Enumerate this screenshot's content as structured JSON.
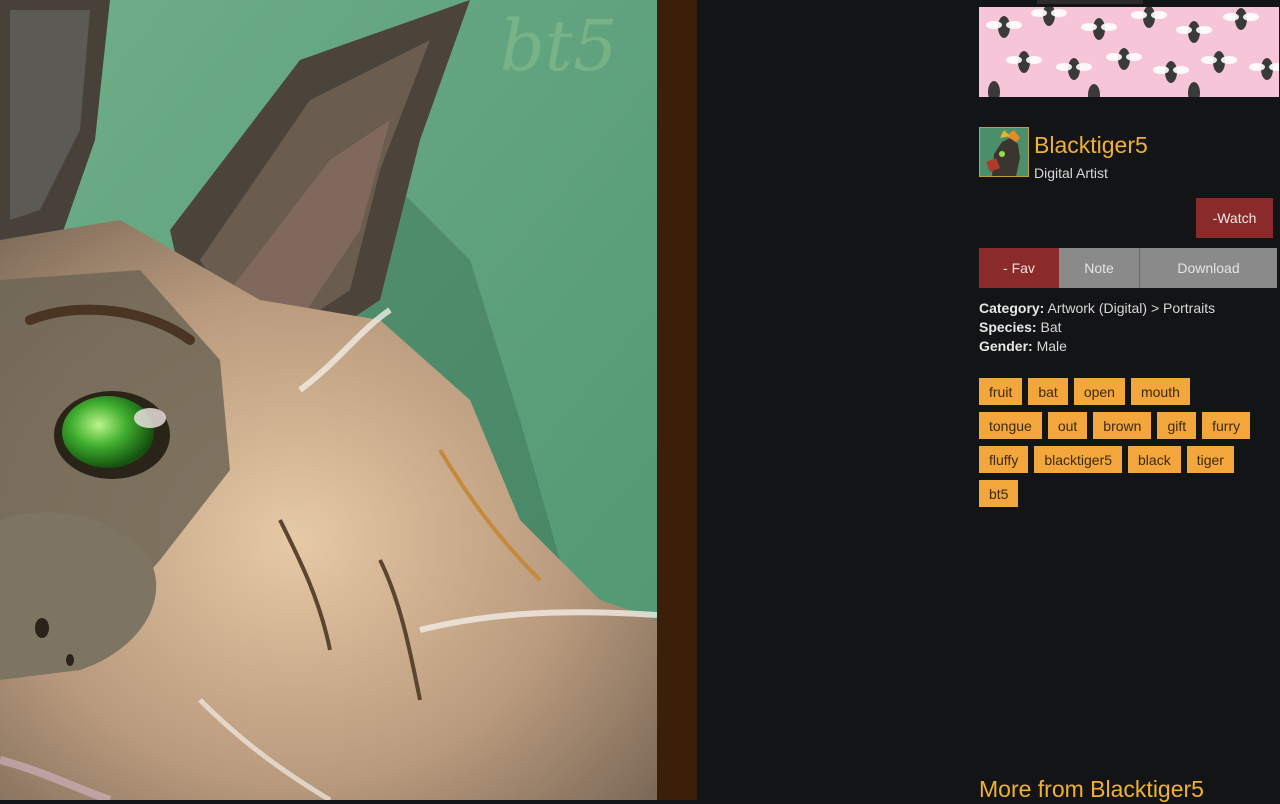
{
  "artist": {
    "name": "Blacktiger5",
    "title": "Digital Artist"
  },
  "buttons": {
    "watch": "-Watch",
    "fav": "- Fav",
    "note": "Note",
    "download": "Download"
  },
  "meta": {
    "category_label": "Category:",
    "category_value": "Artwork (Digital) > Portraits",
    "species_label": "Species:",
    "species_value": "Bat",
    "gender_label": "Gender:",
    "gender_value": "Male"
  },
  "tags": [
    [
      "fruit",
      "bat",
      "open",
      "mouth"
    ],
    [
      "tongue",
      "out",
      "brown",
      "gift",
      "furry"
    ],
    [
      "fluffy",
      "blacktiger5",
      "black",
      "tiger"
    ],
    [
      "bt5"
    ]
  ],
  "more_heading": "More from Blacktiger5",
  "colors": {
    "accent": "#f0b132",
    "tag_bg": "#f3a63b",
    "fav_red": "#8b2a2a",
    "gray_btn": "#8a8a8a",
    "page_bg": "#131416"
  }
}
